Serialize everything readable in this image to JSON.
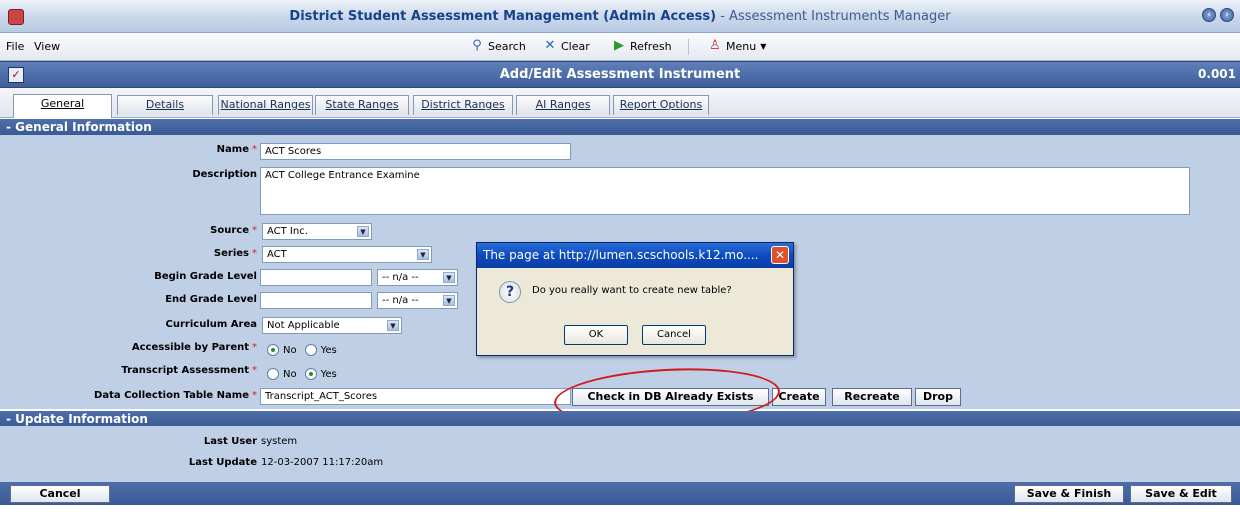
{
  "window": {
    "title_main": "District Student Assessment Management (Admin Access)",
    "title_sub": " - Assessment Instruments Manager"
  },
  "menubar": {
    "file": "File",
    "view": "View",
    "search": "Search",
    "clear": "Clear",
    "refresh": "Refresh",
    "menu": "Menu"
  },
  "header": {
    "title": "Add/Edit Assessment Instrument",
    "value": "0.001"
  },
  "tabs": [
    {
      "label": "General"
    },
    {
      "label": "Details"
    },
    {
      "label": "National Ranges"
    },
    {
      "label": "State Ranges"
    },
    {
      "label": "District Ranges"
    },
    {
      "label": "AI Ranges"
    },
    {
      "label": "Report Options"
    }
  ],
  "general": {
    "heading": "- General Information",
    "name_label": "Name",
    "name_value": "ACT Scores",
    "description_label": "Description",
    "description_value": "ACT College Entrance Examine",
    "source_label": "Source",
    "source_value": "ACT Inc.",
    "series_label": "Series",
    "series_value": "ACT",
    "begin_grade_label": "Begin Grade Level",
    "begin_grade_select": "-- n/a --",
    "end_grade_label": "End Grade Level",
    "end_grade_select": "-- n/a --",
    "curriculum_label": "Curriculum Area",
    "curriculum_value": "Not Applicable",
    "parent_label": "Accessible by Parent",
    "transcript_label": "Transcript Assessment",
    "radio_no": "No",
    "radio_yes": "Yes",
    "table_name_label": "Data Collection Table Name",
    "table_name_value": "Transcript_ACT_Scores",
    "btn_check": "Check in DB Already Exists",
    "btn_create": "Create",
    "btn_recreate": "Recreate",
    "btn_drop": "Drop"
  },
  "update": {
    "heading": "- Update Information",
    "last_user_label": "Last User",
    "last_user_value": "system",
    "last_update_label": "Last Update",
    "last_update_value": "12-03-2007 11:17:20am"
  },
  "footer": {
    "cancel": "Cancel",
    "save_finish": "Save & Finish",
    "save_edit": "Save & Edit"
  },
  "dialog": {
    "title": "The page at http://lumen.scschools.k12.mo....",
    "message": "Do you really want to create new table?",
    "ok": "OK",
    "cancel": "Cancel"
  },
  "colors": {
    "form_bg": "#bfcfe5",
    "header_bg": "#3f5f9b",
    "annotation": "#d21a1a"
  }
}
